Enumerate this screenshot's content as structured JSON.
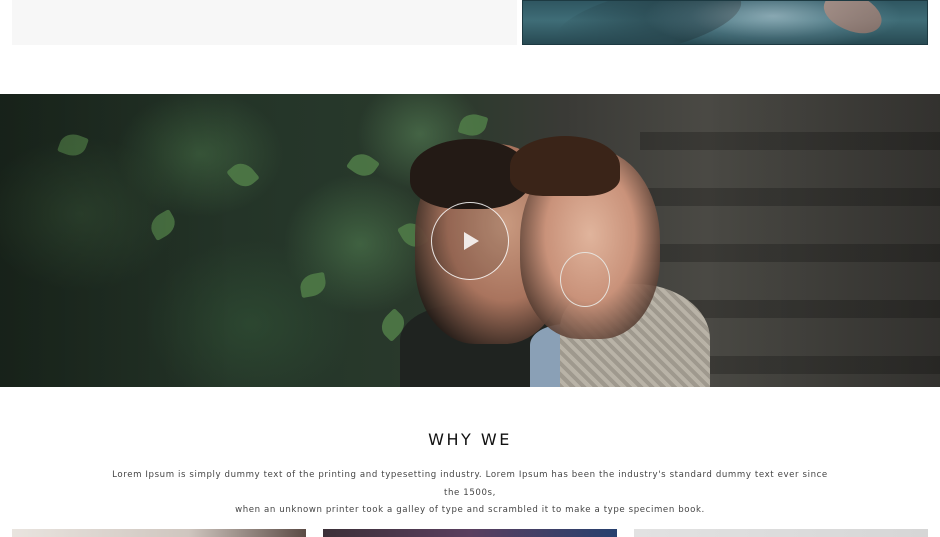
{
  "top": {
    "left_panel": "",
    "right_photo_icon": "water-photo-icon"
  },
  "video": {
    "play_icon": "play-icon"
  },
  "why_we": {
    "title": "WHY WE",
    "description_line1": "Lorem Ipsum is simply dummy text of the printing and typesetting industry. Lorem Ipsum has been the industry's standard dummy text ever since the 1500s,",
    "description_line2": "when an unknown printer took a galley of type and scrambled it to make a type specimen book."
  },
  "thumbnails": [
    "thumb-portrait",
    "thumb-neon",
    "thumb-white"
  ]
}
